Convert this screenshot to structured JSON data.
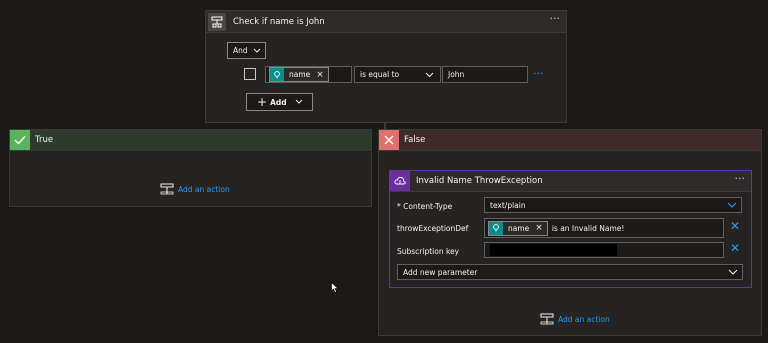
{
  "condition": {
    "title": "Check if name is John",
    "group_operator": "And",
    "token_label": "name",
    "operator": "is equal to",
    "value": "John",
    "add_label": "Add"
  },
  "true_branch": {
    "title": "True",
    "add_action": "Add an action",
    "color": "#5db35d"
  },
  "false_branch": {
    "title": "False",
    "add_action": "Add an action",
    "color": "#e07070"
  },
  "action": {
    "title": "Invalid Name ThrowException",
    "content_type_label": "* Content-Type",
    "content_type_value": "text/plain",
    "throw_label": "throwExceptionDef",
    "throw_token": "name",
    "throw_text": "is an Invalid Name!",
    "subscription_label": "Subscription key",
    "add_param_label": "Add new parameter",
    "accent": "#6b2fa0"
  },
  "more_options": "···"
}
